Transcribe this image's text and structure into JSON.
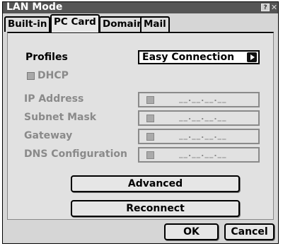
{
  "window": {
    "title": "LAN Mode",
    "help_label": "?",
    "close_label": "✕"
  },
  "tabs": [
    {
      "label": "Built-in",
      "active": false
    },
    {
      "label": "PC Card",
      "active": true
    },
    {
      "label": "Domain",
      "active": false
    },
    {
      "label": "Mail",
      "active": false
    }
  ],
  "profiles": {
    "label": "Profiles",
    "value": "Easy Connection"
  },
  "dhcp": {
    "label": "DHCP",
    "checked": false
  },
  "fields": [
    {
      "label": "IP Address",
      "value": "__.__.__.__"
    },
    {
      "label": "Subnet Mask",
      "value": "__.__.__.__"
    },
    {
      "label": "Gateway",
      "value": "__.__.__.__"
    },
    {
      "label": "DNS Configuration",
      "value": "__.__.__.__"
    }
  ],
  "buttons": {
    "advanced": "Advanced",
    "reconnect": "Reconnect",
    "ok": "OK",
    "cancel": "Cancel"
  }
}
